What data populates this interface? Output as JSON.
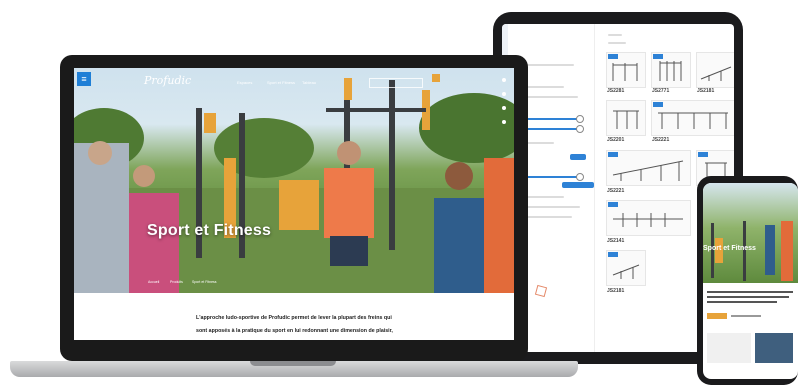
{
  "laptop": {
    "logo": "Profudic",
    "nav": [
      "Espaces",
      "Sport et Fitness",
      "Tableau"
    ],
    "hero_title": "Sport et Fitness",
    "breadcrumb": [
      "Accueil",
      "Produits",
      "Sport et Fitness"
    ],
    "intro_text": "L'approche ludo-sportive de Profudic permet de lever la plupart des freins qui sont apposés à la pratique du sport en lui redonnant une dimension de plaisir, de loisir et de bien-être.",
    "menu_icon": "hamburger-icon",
    "accent": "#1f7fd6"
  },
  "tablet": {
    "products": [
      {
        "code": "JS2281"
      },
      {
        "code": "JS2771"
      },
      {
        "code": "JS2181"
      },
      {
        "code": "JS2201"
      },
      {
        "code": "JS2221"
      },
      {
        "code": "JS2221"
      },
      {
        "code": "JS2141"
      },
      {
        "code": "JS2181"
      }
    ]
  },
  "phone": {
    "hero_title": "Sport et Fitness"
  }
}
